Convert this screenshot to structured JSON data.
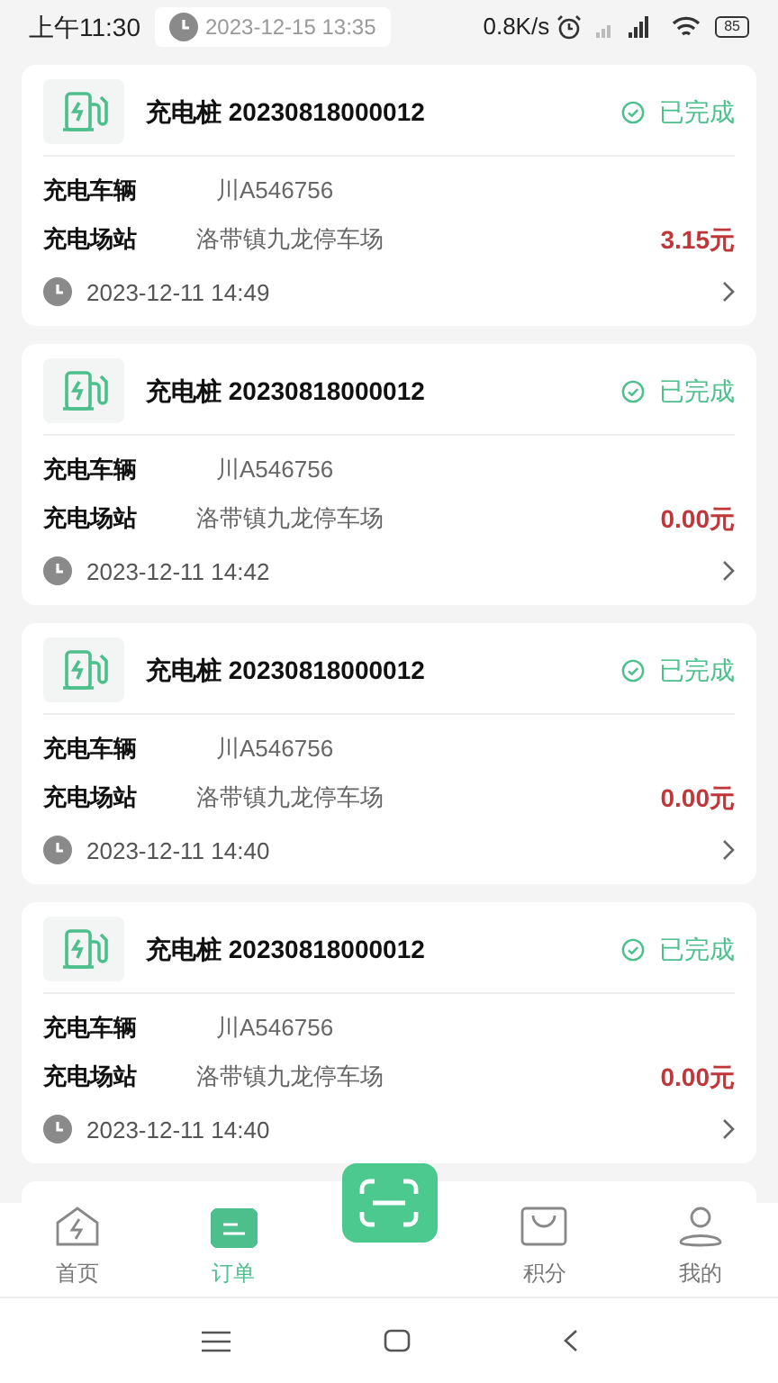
{
  "status_bar": {
    "time": "上午11:30",
    "speed": "0.8K/s",
    "battery": "85"
  },
  "partial_order": {
    "time": "2023-12-15 13:35"
  },
  "orders": [
    {
      "title": "充电桩 20230818000012",
      "status": "已完成",
      "vehicle_label": "充电车辆",
      "vehicle": "川A546756",
      "station_label": "充电场站",
      "station": "洛带镇九龙停车场",
      "amount": "3.15元",
      "time": "2023-12-11 14:49"
    },
    {
      "title": "充电桩 20230818000012",
      "status": "已完成",
      "vehicle_label": "充电车辆",
      "vehicle": "川A546756",
      "station_label": "充电场站",
      "station": "洛带镇九龙停车场",
      "amount": "0.00元",
      "time": "2023-12-11 14:42"
    },
    {
      "title": "充电桩 20230818000012",
      "status": "已完成",
      "vehicle_label": "充电车辆",
      "vehicle": "川A546756",
      "station_label": "充电场站",
      "station": "洛带镇九龙停车场",
      "amount": "0.00元",
      "time": "2023-12-11 14:40"
    },
    {
      "title": "充电桩 20230818000012",
      "status": "已完成",
      "vehicle_label": "充电车辆",
      "vehicle": "川A546756",
      "station_label": "充电场站",
      "station": "洛带镇九龙停车场",
      "amount": "0.00元",
      "time": "2023-12-11 14:40"
    }
  ],
  "tabs": [
    {
      "kind": "home",
      "label": "首页",
      "selected": false
    },
    {
      "kind": "orders",
      "label": "订单",
      "selected": true
    },
    {
      "kind": "scan",
      "selected": false
    },
    {
      "kind": "points",
      "label": "积分",
      "selected": false
    },
    {
      "kind": "me",
      "label": "我的",
      "selected": false
    }
  ]
}
